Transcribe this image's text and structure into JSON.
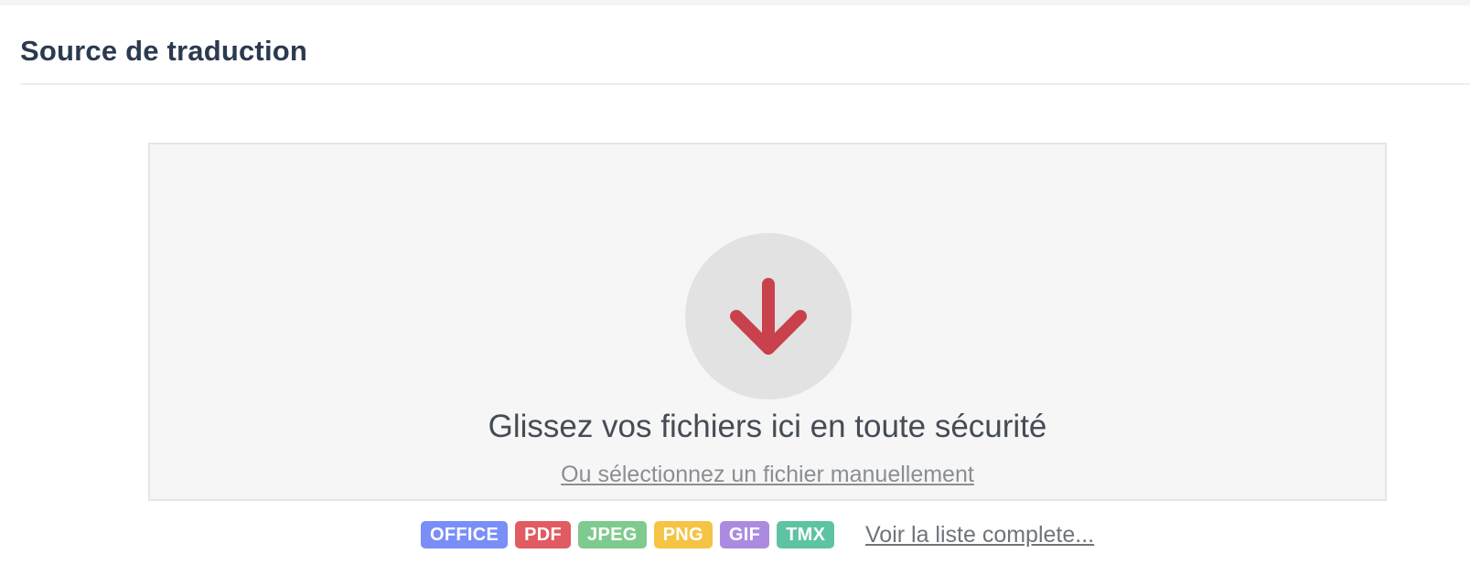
{
  "section": {
    "title": "Source de traduction"
  },
  "dropzone": {
    "icon": "arrow-down-icon",
    "icon_color": "#c8414d",
    "circle_color": "#e2e2e2",
    "headline": "Glissez vos fichiers ici en toute sécurité",
    "manual_select_label": "Ou sélectionnez un fichier manuellement"
  },
  "formats": {
    "badges": [
      {
        "label": "OFFICE",
        "color": "#7a8ef7"
      },
      {
        "label": "PDF",
        "color": "#e15b62"
      },
      {
        "label": "JPEG",
        "color": "#7fca8e"
      },
      {
        "label": "PNG",
        "color": "#f5c445"
      },
      {
        "label": "GIF",
        "color": "#ab8be0"
      },
      {
        "label": "TMX",
        "color": "#5ec3a3"
      }
    ],
    "full_list_label": "Voir la liste complete..."
  }
}
